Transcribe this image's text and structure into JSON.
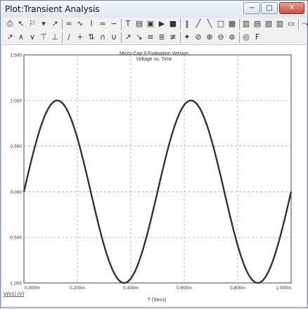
{
  "window": {
    "title": "Plot:Transient Analysis",
    "min_label": "−",
    "max_label": "□",
    "close_label": "✕"
  },
  "toolbar1": [
    {
      "name": "print-icon",
      "glyph": "⎙"
    },
    {
      "name": "select-arrow-icon",
      "glyph": "↖"
    },
    {
      "name": "zoom-options-icon",
      "glyph": "⚐"
    },
    {
      "name": "dropdown-icon",
      "glyph": "▾"
    },
    {
      "name": "plot-icon",
      "glyph": "↗"
    },
    {
      "name": "plot2-icon",
      "glyph": "≈"
    },
    {
      "name": "wave-icon",
      "glyph": "∿"
    },
    {
      "name": "wave2-icon",
      "glyph": "⌇"
    },
    {
      "name": "wave3-icon",
      "glyph": "≈"
    },
    {
      "name": "wave4-icon",
      "glyph": "∽"
    },
    {
      "name": "text-icon",
      "glyph": "T"
    },
    {
      "name": "stats-icon",
      "glyph": "▤"
    },
    {
      "name": "palette-icon",
      "glyph": "▣"
    },
    {
      "name": "run-icon",
      "glyph": "▶"
    },
    {
      "name": "stop-icon",
      "glyph": "■"
    },
    {
      "name": "pause-icon",
      "glyph": "‖"
    },
    {
      "name": "line-icon",
      "glyph": "╱"
    },
    {
      "name": "line2-icon",
      "glyph": "╲"
    },
    {
      "name": "frame-icon",
      "glyph": "□"
    },
    {
      "name": "grid-icon",
      "glyph": "▦"
    },
    {
      "name": "layout1-icon",
      "glyph": "▥"
    },
    {
      "name": "layout2-icon",
      "glyph": "▤"
    },
    {
      "name": "layout3-icon",
      "glyph": "▧"
    },
    {
      "name": "layout4-icon",
      "glyph": "▥"
    },
    {
      "name": "layout5-icon",
      "glyph": "▭"
    },
    {
      "name": "curve-icon",
      "glyph": "⤳"
    }
  ],
  "toolbar2": [
    {
      "name": "cursor-icon",
      "glyph": "↗"
    },
    {
      "name": "peak-icon",
      "glyph": "∧"
    },
    {
      "name": "valley-icon",
      "glyph": "∨"
    },
    {
      "name": "high-icon",
      "glyph": "⊤"
    },
    {
      "name": "low-icon",
      "glyph": "⊥"
    },
    {
      "name": "slope-icon",
      "glyph": "∕"
    },
    {
      "name": "plus-icon",
      "glyph": "+"
    },
    {
      "name": "minmax-icon",
      "glyph": "⇅"
    },
    {
      "name": "hump-icon",
      "glyph": "∩"
    },
    {
      "name": "dip-icon",
      "glyph": "∪"
    },
    {
      "name": "rise-icon",
      "glyph": "↗"
    },
    {
      "name": "fall-icon",
      "glyph": "↘"
    },
    {
      "name": "level-icon",
      "glyph": "≡"
    },
    {
      "name": "tagV-icon",
      "glyph": "≣"
    },
    {
      "name": "tagH-icon",
      "glyph": "≢"
    },
    {
      "name": "point-icon",
      "glyph": "✦"
    },
    {
      "name": "tag-icon",
      "glyph": "⊘"
    },
    {
      "name": "zoomin-icon",
      "glyph": "⊕"
    },
    {
      "name": "zoomout-icon",
      "glyph": "⊖"
    },
    {
      "name": "zoomfit-icon",
      "glyph": "⊛"
    },
    {
      "name": "color-icon",
      "glyph": "◎"
    },
    {
      "name": "font-icon",
      "glyph": "F"
    }
  ],
  "chart_data": {
    "type": "line",
    "title": "Micro-Cap 9 Evaluation Version",
    "subtitle": "Voltage vs. Time",
    "xlabel": "T (Secs)",
    "series_label": "V(V1) (V)",
    "xlim": [
      0,
      1.0
    ],
    "ylim": [
      -1.0,
      1.0
    ],
    "x_unit": "ms",
    "x_ticks": [
      "0.000m",
      "0.200m",
      "0.400m",
      "0.600m",
      "0.800m",
      "1.000m"
    ],
    "y_ticks": [
      "1.500",
      "1.000",
      "0.500",
      "0.000",
      "-0.500",
      "-1.000"
    ],
    "y_tick_values": [
      1.5,
      1.0,
      0.5,
      0.0,
      -0.5,
      -1.0
    ],
    "grid": true,
    "series": [
      {
        "name": "V(V1) (V)",
        "color": "#333333",
        "function": "sin(2*pi*2000*t)",
        "frequency_hz": 2000,
        "amplitude": 1.0
      }
    ]
  }
}
